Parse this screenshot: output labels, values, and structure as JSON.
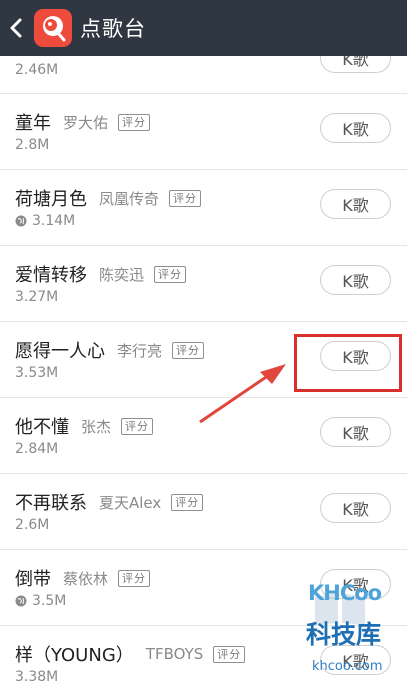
{
  "header": {
    "title": "点歌台"
  },
  "labels": {
    "k_button": "K歌",
    "score_badge": "评分"
  },
  "songs": [
    {
      "title": "",
      "artist": "",
      "size": "2.46M",
      "scored": false,
      "global": false
    },
    {
      "title": "童年",
      "artist": "罗大佑",
      "size": "2.8M",
      "scored": true,
      "global": false
    },
    {
      "title": "荷塘月色",
      "artist": "凤凰传奇",
      "size": "3.14M",
      "scored": true,
      "global": true
    },
    {
      "title": "爱情转移",
      "artist": "陈奕迅",
      "size": "3.27M",
      "scored": true,
      "global": false
    },
    {
      "title": "愿得一人心",
      "artist": "李行亮",
      "size": "3.53M",
      "scored": true,
      "global": false
    },
    {
      "title": "他不懂",
      "artist": "张杰",
      "size": "2.84M",
      "scored": true,
      "global": false
    },
    {
      "title": "不再联系",
      "artist": "夏天Alex",
      "size": "2.6M",
      "scored": true,
      "global": false
    },
    {
      "title": "倒带",
      "artist": "蔡依林",
      "size": "3.5M",
      "scored": true,
      "global": true
    },
    {
      "title": "样（YOUNG）",
      "artist": "TFBOYS",
      "size": "3.38M",
      "scored": true,
      "global": false
    }
  ],
  "watermark": {
    "logo": "KHCoo",
    "name": "科技库",
    "url": "khcoo.com"
  },
  "colors": {
    "header_bg": "#2f3742",
    "accent_red": "#d9302b",
    "logo_bg": "#ef4b3d",
    "watermark_blue": "#1e6fb3"
  }
}
